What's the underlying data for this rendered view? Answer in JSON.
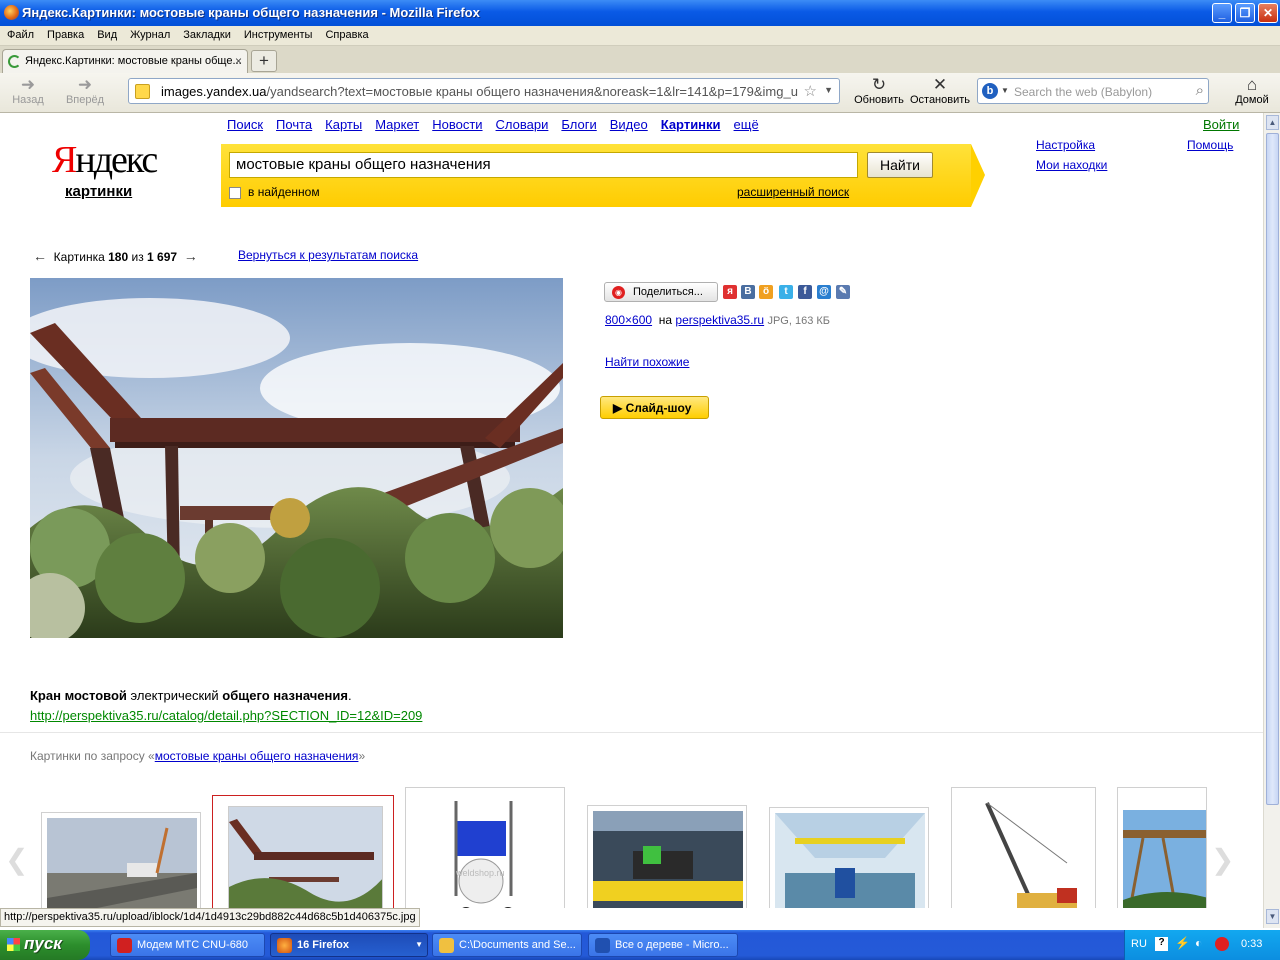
{
  "window": {
    "title": "Яндекс.Картинки: мостовые краны общего назначения - Mozilla Firefox"
  },
  "menu": [
    "Файл",
    "Правка",
    "Вид",
    "Журнал",
    "Закладки",
    "Инструменты",
    "Справка"
  ],
  "tab": {
    "title": "Яндекс.Картинки: мостовые краны обще...",
    "close": "×",
    "new": "+"
  },
  "nav": {
    "back": "Назад",
    "forward": "Вперёд",
    "reload": "Обновить",
    "stop": "Остановить",
    "home": "Домой"
  },
  "url": {
    "host": "images.yandex.ua",
    "path": "/yandsearch?text=мостовые краны общего назначения&noreask=1&lr=141&p=179&img_u"
  },
  "websearch": {
    "placeholder": "Search the web (Babylon)"
  },
  "yandex": {
    "logo_ya": "Я",
    "logo_rest": "ндекс",
    "sub": "картинки",
    "services": [
      "Поиск",
      "Почта",
      "Карты",
      "Маркет",
      "Новости",
      "Словари",
      "Блоги",
      "Видео",
      "Картинки",
      "ещё"
    ],
    "active_service": "Картинки",
    "query": "мостовые краны общего назначения",
    "find_button": "Найти",
    "in_found": "в найденном",
    "advanced": "расширенный поиск",
    "settings": "Настройка",
    "my_finds": "Мои находки",
    "help": "Помощь",
    "login": "Войти"
  },
  "viewer": {
    "counter_prefix": "Картинка",
    "index": "180",
    "of": "из",
    "total": "1 697",
    "back_to_results": "Вернуться к результатам поиска",
    "share": "Поделиться...",
    "social": [
      "Я.ру",
      "В",
      "Одноклассники",
      "Twitter",
      "Facebook",
      "Мой Мир",
      "LiveJournal"
    ],
    "size": "800×600",
    "on": "на",
    "site": "perspektiva35.ru",
    "meta": "JPG, 163 КБ",
    "similar": "Найти похожие",
    "slideshow": "Слайд-шоу",
    "caption_bold1": "Кран мостовой",
    "caption_mid": " электрический ",
    "caption_bold2": "общего назначения",
    "caption_end": ".",
    "source_url": "http://perspektiva35.ru/catalog/detail.php?SECTION_ID=12&ID=209",
    "related_prefix": "Картинки по запросу «",
    "related_query": "мостовые краны общего назначения",
    "related_suffix": "»"
  },
  "thumbnails": [
    {
      "subject": "bridge-construction"
    },
    {
      "subject": "gantry-crane",
      "selected": true
    },
    {
      "subject": "wire-cart",
      "watermark": "weldshop.ru"
    },
    {
      "subject": "factory-crane"
    },
    {
      "subject": "workshop-hall"
    },
    {
      "subject": "tower-crawler-crane"
    },
    {
      "subject": "gantry-sky"
    }
  ],
  "status_text": "http://perspektiva35.ru/upload/iblock/1d4/1d4913c29bd882c44d68c5b1d406375c.jpg",
  "taskbar": {
    "start": "пуск",
    "tasks": [
      {
        "label": "Модем МТС CNU-680"
      },
      {
        "label": "16 Firefox"
      },
      {
        "label": "C:\\Documents and Se..."
      },
      {
        "label": "Все о дереве - Micro..."
      }
    ],
    "lang": "RU",
    "clock": "0:33"
  },
  "colors": {
    "yandex_yellow": "#ffcc00",
    "link": "#0000cc",
    "source_green": "#008800",
    "xp_blue": "#245ad8"
  }
}
